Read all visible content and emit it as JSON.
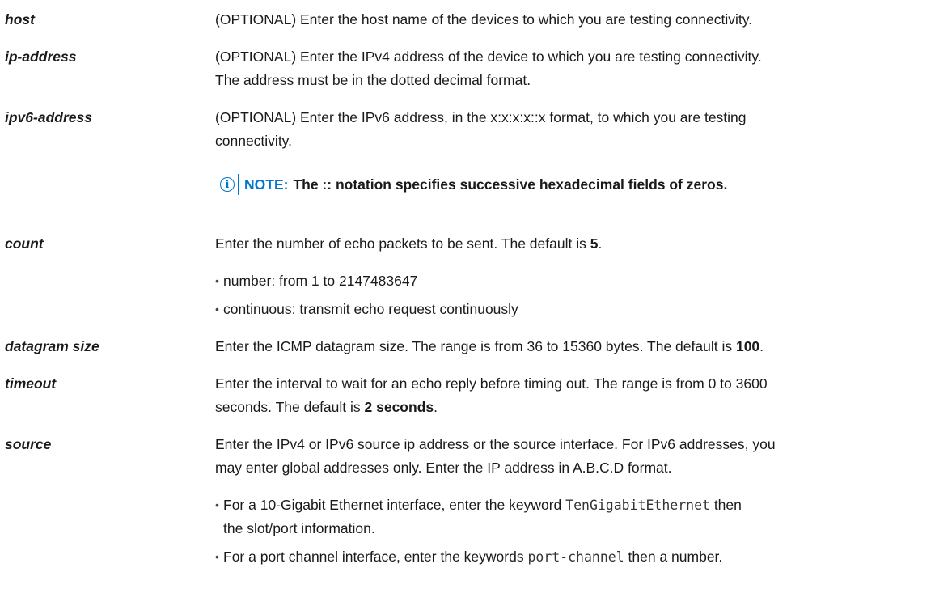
{
  "params": {
    "host": {
      "term": "host",
      "desc": "(OPTIONAL) Enter the host name of the devices to which you are testing connectivity."
    },
    "ip_address": {
      "term": "ip-address",
      "desc_line1": "(OPTIONAL) Enter the IPv4 address of the device to which you are testing connectivity.",
      "desc_line2": "The address must be in the dotted decimal format."
    },
    "ipv6_address": {
      "term": "ipv6-address",
      "desc_line1": "(OPTIONAL) Enter the IPv6 address, in the x:x:x:x::x format, to which you are testing",
      "desc_line2": "connectivity."
    },
    "note": {
      "icon": "info-icon",
      "label": "NOTE:",
      "text": "The :: notation specifies successive hexadecimal fields of zeros.",
      "color": "#0076ce"
    },
    "count": {
      "term": "count",
      "desc_prefix": "Enter the number of echo packets to be sent. The default is ",
      "desc_default": "5",
      "desc_suffix": ".",
      "bullets": [
        "number: from 1 to 2147483647",
        "continuous: transmit echo request continuously"
      ]
    },
    "datagram_size": {
      "term": "datagram size",
      "desc_prefix": "Enter the ICMP datagram size. The range is from 36 to 15360 bytes. The default is ",
      "desc_default": "100",
      "desc_suffix": "."
    },
    "timeout": {
      "term": "timeout",
      "desc_line1": "Enter the interval to wait for an echo reply before timing out. The range is from 0 to 3600",
      "desc_line2_prefix": "seconds. The default is ",
      "desc_default": "2 seconds",
      "desc_suffix": "."
    },
    "source": {
      "term": "source",
      "desc_line1": "Enter the IPv4 or IPv6 source ip address or the source interface. For IPv6 addresses, you",
      "desc_line2": "may enter global addresses only. Enter the IP address in A.B.C.D format.",
      "bullet1_prefix": "For a 10-Gigabit Ethernet interface, enter the keyword ",
      "bullet1_code": "TenGigabitEthernet",
      "bullet1_suffix": " then",
      "bullet1_line2": "the slot/port information.",
      "bullet2_prefix": "For a port channel interface, enter the keywords ",
      "bullet2_code": "port-channel",
      "bullet2_suffix": " then a number."
    }
  },
  "bullet_char": "•"
}
